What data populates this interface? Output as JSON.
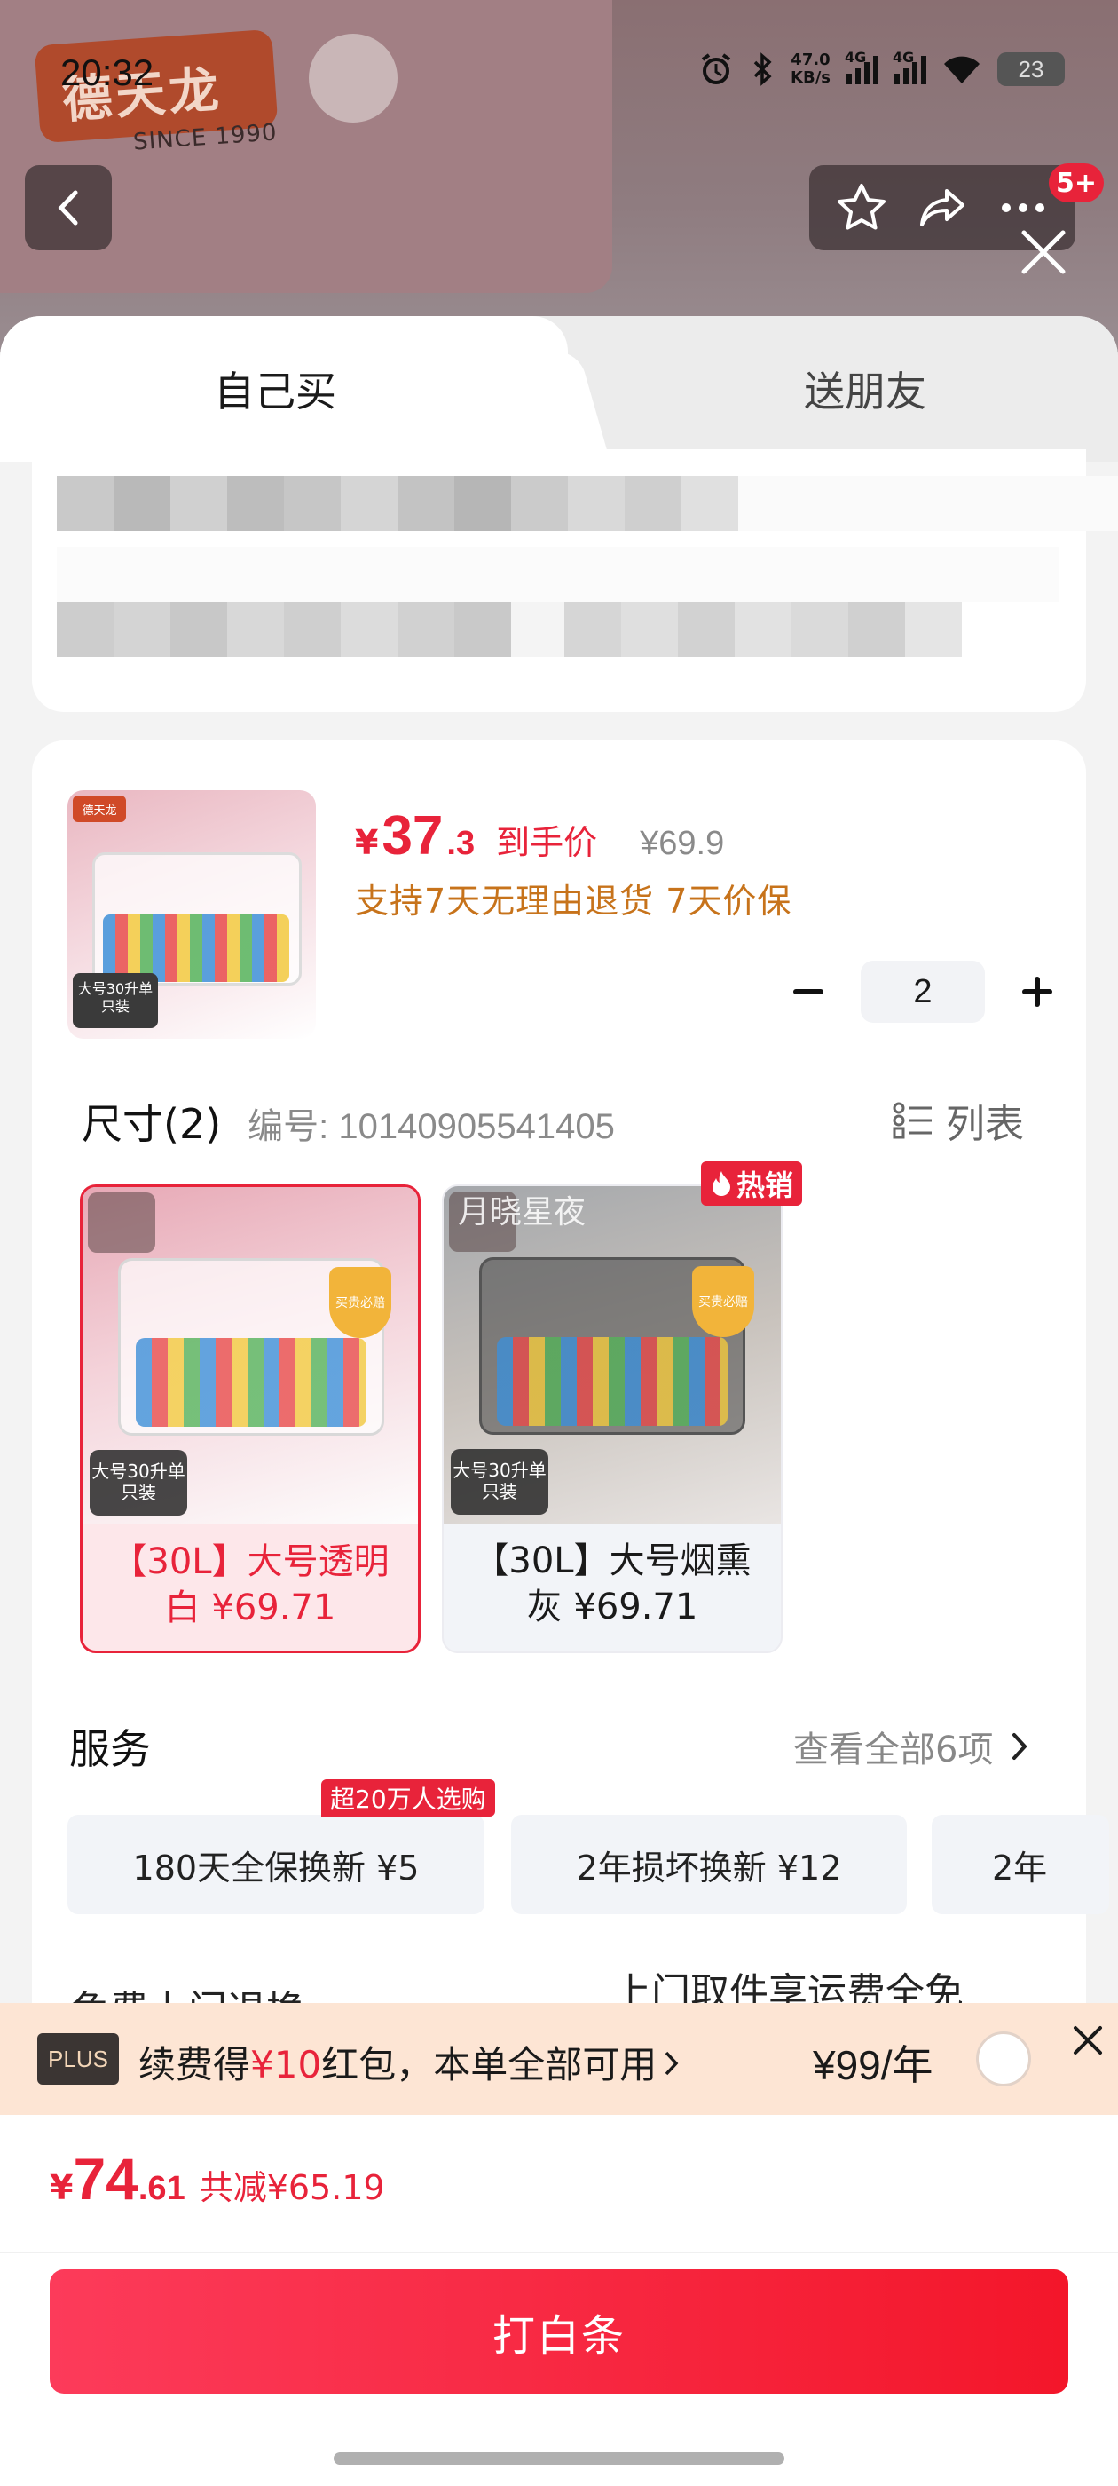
{
  "status_bar": {
    "time": "20:32",
    "speed_value": "47.0",
    "speed_unit": "KB/s",
    "net_1": "4G",
    "net_2": "4G",
    "battery": "23"
  },
  "background": {
    "logo_text": "德天龙",
    "since": "SINCE 1990"
  },
  "nav": {
    "badge_count": "5+"
  },
  "tabs": [
    {
      "label": "自己买",
      "selected": true
    },
    {
      "label": "送朋友",
      "selected": false
    }
  ],
  "product": {
    "price_yen": "¥",
    "price_int": "37",
    "price_dec": ".3",
    "price_label": "到手价",
    "original_price": "¥69.9",
    "policy": "支持7天无理由退货 7天价保",
    "quantity": "2",
    "thumb_tag": "大号30升单只装"
  },
  "size": {
    "title": "尺寸(2)",
    "code": "编号: 10140905541405",
    "list_label": "列表",
    "options": [
      {
        "label": "【30L】大号透明白 ¥69.71",
        "tag": "大号30升单只装",
        "selected": true
      },
      {
        "label": "【30L】大号烟熏灰 ¥69.71",
        "tag": "大号30升单只装",
        "watermark": "月晓星夜",
        "selected": false
      }
    ],
    "hot_label": "热销",
    "shield_text": "买贵必赔"
  },
  "services": {
    "title": "服务",
    "more": "查看全部6项",
    "badge": "超20万人选购",
    "items": [
      {
        "label": "180天全保换新  ¥5"
      },
      {
        "label": "2年损坏换新  ¥12"
      },
      {
        "label": "2年"
      }
    ]
  },
  "peek": {
    "left": "免费上门退换",
    "right": "上门取件享运费全免"
  },
  "plus": {
    "badge": "PLUS",
    "text_pre": "续费得",
    "text_amount": "¥10",
    "text_post": "红包，本单全部可用",
    "price": "¥99/年"
  },
  "total": {
    "yen": "¥",
    "int": "74",
    "dec": ".61",
    "saved": "共减¥65.19"
  },
  "pay_button": "打白条",
  "colors": {
    "accent": "#e8233a",
    "policy": "#c7731b",
    "plus_bg": "#fde5d4"
  }
}
